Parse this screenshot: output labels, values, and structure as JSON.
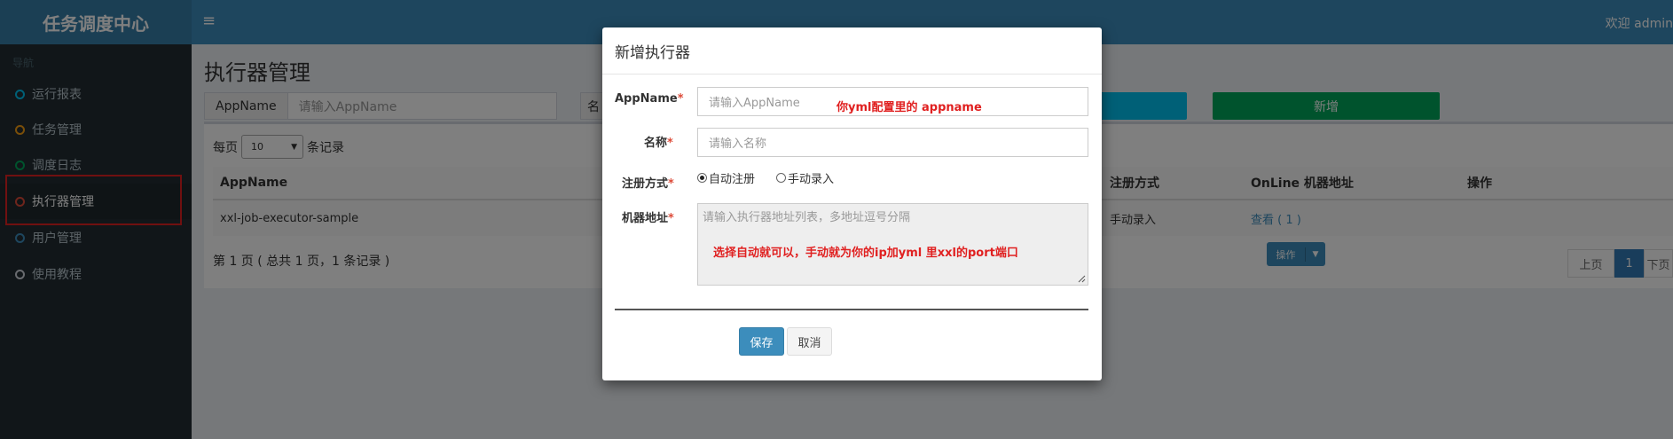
{
  "header": {
    "logo": "任务调度中心",
    "menu_toggle_icon": "≡",
    "welcome": "欢迎 admin"
  },
  "sidebar": {
    "header": "导航",
    "items": [
      {
        "label": "运行报表",
        "color": "#00c0ef"
      },
      {
        "label": "任务管理",
        "color": "#f39c12"
      },
      {
        "label": "调度日志",
        "color": "#00a65a"
      },
      {
        "label": "执行器管理",
        "color": "#dd4b39"
      },
      {
        "label": "用户管理",
        "color": "#3c8dbc"
      },
      {
        "label": "使用教程",
        "color": "#d2d6de"
      }
    ]
  },
  "main": {
    "title": "执行器管理",
    "search": {
      "addon": "AppName",
      "placeholder": "请输入AppName",
      "second_addon": "名"
    },
    "add_label": "新增",
    "perpage": {
      "prefix": "每页",
      "value": "10",
      "suffix": "条记录"
    },
    "columns": [
      "AppName",
      "注册方式",
      "OnLine 机器地址",
      "操作"
    ],
    "rows": [
      {
        "appname": "xxl-job-executor-sample",
        "reg": "手动录入",
        "online": "查看 ( 1 )",
        "op": "操作"
      }
    ],
    "page_info": "第 1 页 ( 总共 1 页，1 条记录 )",
    "pager": {
      "prev": "上页",
      "current": "1",
      "next": "下页"
    }
  },
  "modal": {
    "title": "新增执行器",
    "appname_label": "AppName",
    "appname_placeholder": "请输入AppName",
    "appname_note": "你yml配置里的 appname",
    "name_label": "名称",
    "name_placeholder": "请输入名称",
    "reg_label": "注册方式",
    "reg_auto": "自动注册",
    "reg_manual": "手动录入",
    "addr_label": "机器地址",
    "addr_placeholder": "请输入执行器地址列表，多地址逗号分隔",
    "addr_note": "选择自动就可以，手动就为你的ip加yml 里xxl的port端口",
    "required_mark": "*",
    "save": "保存",
    "cancel": "取消"
  }
}
